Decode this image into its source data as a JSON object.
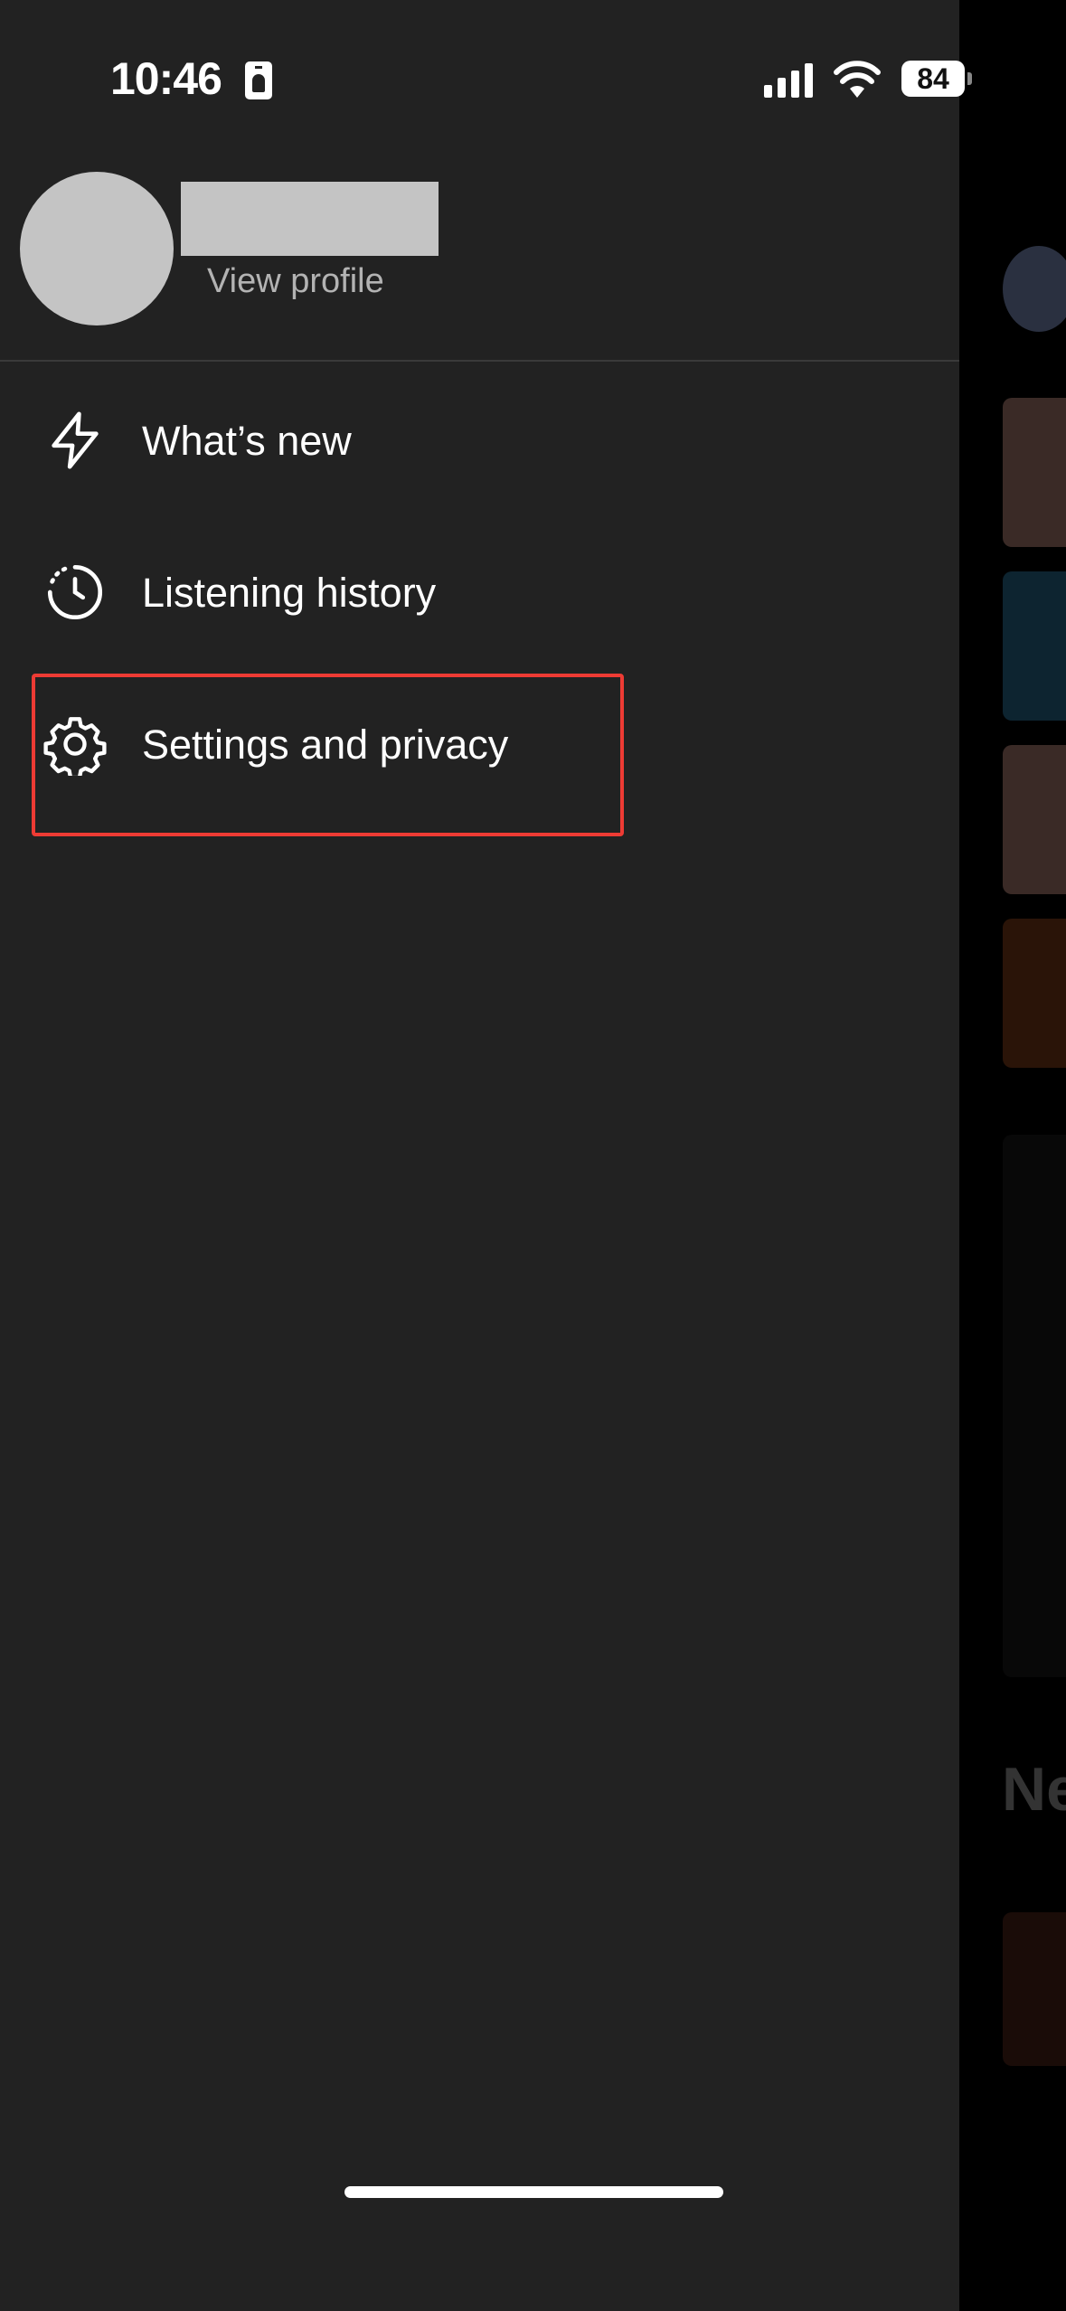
{
  "status_bar": {
    "time": "10:46",
    "battery": "84"
  },
  "profile": {
    "view_profile_label": "View profile"
  },
  "menu": [
    {
      "label": "What’s new",
      "icon": "lightning-icon"
    },
    {
      "label": "Listening history",
      "icon": "clock-history-icon"
    },
    {
      "label": "Settings and privacy",
      "icon": "gear-icon"
    }
  ],
  "background": {
    "section_heading_partial": "Ne"
  },
  "colors": {
    "drawer_bg": "#222222",
    "highlight": "#ee3b34",
    "placeholder": "#c4c4c4"
  }
}
